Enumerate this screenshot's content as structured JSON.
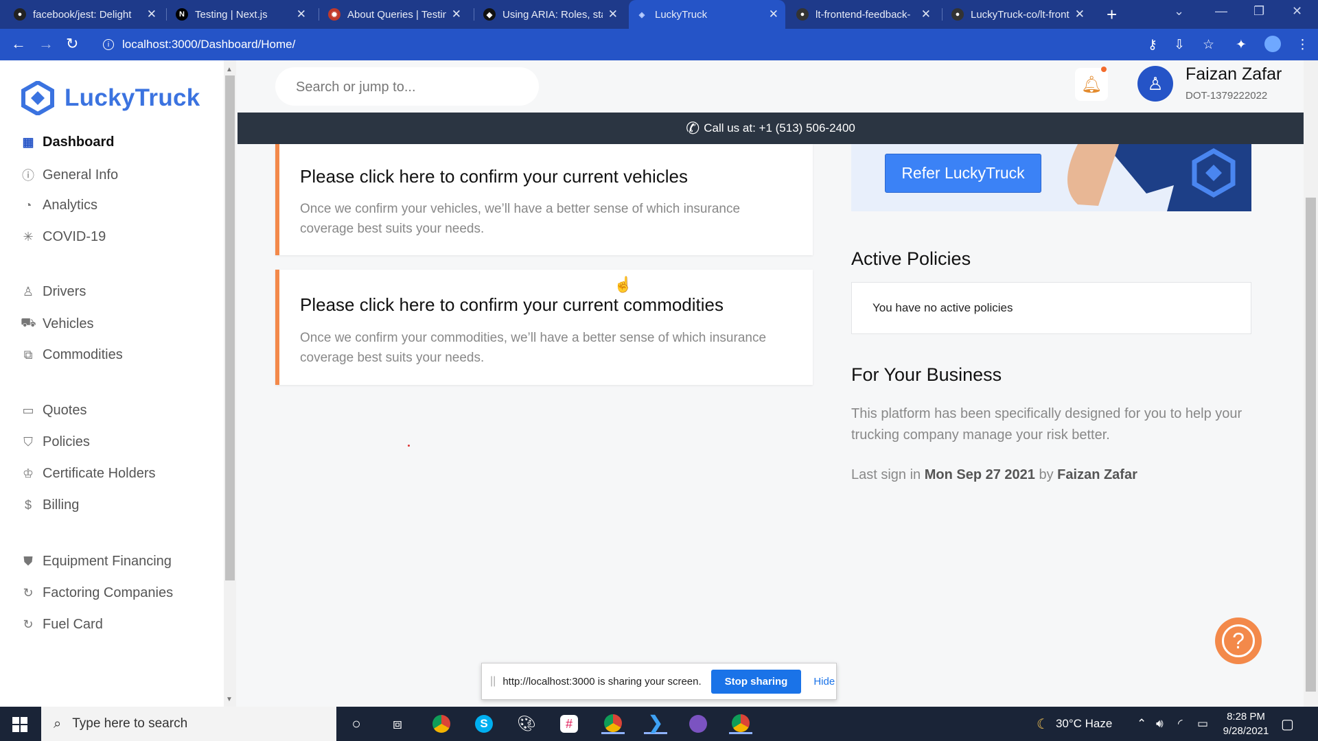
{
  "browser": {
    "tabs": [
      {
        "title": "facebook/jest: Delight",
        "icon": "github-icon"
      },
      {
        "title": "Testing | Next.js",
        "icon": "nextjs-icon"
      },
      {
        "title": "About Queries | Testin",
        "icon": "testing-library-icon"
      },
      {
        "title": "Using ARIA: Roles, sta",
        "icon": "mdn-icon"
      },
      {
        "title": "LuckyTruck",
        "icon": "luckytruck-icon",
        "active": true
      },
      {
        "title": "lt-frontend-feedback-",
        "icon": "github-icon"
      },
      {
        "title": "LuckyTruck-co/lt-front",
        "icon": "github-icon"
      }
    ],
    "url": "localhost:3000/Dashboard/Home/"
  },
  "sidebar": {
    "brand": "LuckyTruck",
    "items": [
      {
        "label": "Dashboard",
        "icon": "dashboard-icon",
        "active": true
      },
      {
        "label": "General Info",
        "icon": "info-icon"
      },
      {
        "label": "Analytics",
        "icon": "pie-chart-icon"
      },
      {
        "label": "COVID-19",
        "icon": "virus-icon"
      },
      {
        "label": "Drivers",
        "icon": "user-icon"
      },
      {
        "label": "Vehicles",
        "icon": "truck-icon"
      },
      {
        "label": "Commodities",
        "icon": "boxes-icon"
      },
      {
        "label": "Quotes",
        "icon": "message-icon"
      },
      {
        "label": "Policies",
        "icon": "shield-check-icon"
      },
      {
        "label": "Certificate Holders",
        "icon": "award-icon"
      },
      {
        "label": "Billing",
        "icon": "dollar-icon"
      },
      {
        "label": "Equipment Financing",
        "icon": "shield-icon"
      },
      {
        "label": "Factoring Companies",
        "icon": "refresh-icon"
      },
      {
        "label": "Fuel Card",
        "icon": "refresh-icon"
      }
    ]
  },
  "header": {
    "search_placeholder": "Search or jump to...",
    "user_name": "Faizan Zafar",
    "user_id": "DOT-1379222022"
  },
  "callbar": {
    "text": "Call us at: +1 (513) 506-2400"
  },
  "cards": [
    {
      "title": "Please click here to confirm your current vehicles",
      "body": "Once we confirm your vehicles, we’ll have a better sense of which insurance coverage best suits your needs."
    },
    {
      "title": "Please click here to confirm your current commodities",
      "body": "Once we confirm your commodities, we’ll have a better sense of which insurance coverage best suits your needs."
    }
  ],
  "refer": {
    "button": "Refer LuckyTruck"
  },
  "active_policies": {
    "title": "Active Policies",
    "empty_text": "You have no active policies"
  },
  "business": {
    "title": "For Your Business",
    "text": "This platform has been specifically designed for you to help your trucking company manage your risk better.",
    "last_sign_prefix": "Last sign in",
    "last_sign_date": "Mon Sep 27 2021",
    "last_sign_by": "by",
    "last_sign_user": "Faizan Zafar"
  },
  "share_bar": {
    "text": "http://localhost:3000 is sharing your screen.",
    "stop": "Stop sharing",
    "hide": "Hide"
  },
  "taskbar": {
    "search_placeholder": "Type here to search",
    "weather": "30°C  Haze",
    "time": "8:28 PM",
    "date": "9/28/2021"
  },
  "colors": {
    "accent": "#2554c7",
    "brand": "#3b73e0",
    "card_border": "#f3894a"
  }
}
